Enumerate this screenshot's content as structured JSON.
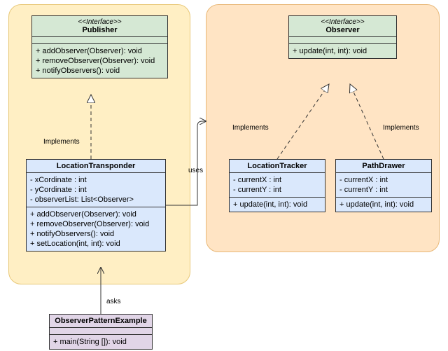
{
  "publisher": {
    "stereo": "<<Interface>>",
    "name": "Publisher",
    "methods": [
      "+ addObserver(Observer): void",
      "+ removeObserver(Observer): void",
      "+ notifyObservers(): void"
    ]
  },
  "observer": {
    "stereo": "<<Interface>>",
    "name": "Observer",
    "methods": [
      "+ update(int, int): void"
    ]
  },
  "locationTransponder": {
    "name": "LocationTransponder",
    "attrs": [
      "- xCordinate : int",
      "- yCordinate : int",
      "- observerList: List<Observer>"
    ],
    "methods": [
      "+ addObserver(Observer): void",
      "+ removeObserver(Observer): void",
      "+ notifyObservers(): void",
      "+ setLocation(int, int): void"
    ]
  },
  "locationTracker": {
    "name": "LocationTracker",
    "attrs": [
      "- currentX : int",
      "- currentY : int"
    ],
    "methods": [
      "+ update(int, int): void"
    ]
  },
  "pathDrawer": {
    "name": "PathDrawer",
    "attrs": [
      "- currentX : int",
      "- currentY : int"
    ],
    "methods": [
      "+ update(int, int): void"
    ]
  },
  "observerPatternExample": {
    "name": "ObserverPatternExample",
    "methods": [
      "+ main(String []): void"
    ]
  },
  "labels": {
    "implements1": "Implements",
    "implements2": "Implements",
    "implements3": "Implements",
    "uses": "uses",
    "asks": "asks"
  }
}
